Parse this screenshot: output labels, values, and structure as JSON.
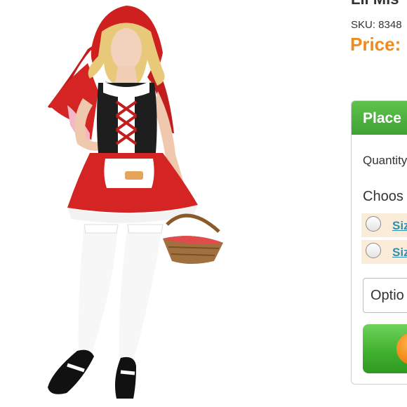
{
  "product": {
    "title": "Lil Mis",
    "sku": "SKU: 8348",
    "price_label": "Price:",
    "image_alt": "Red riding hood costume"
  },
  "order_box": {
    "header": "Place",
    "quantity_label": "Quantity",
    "choose_label": "Choos",
    "size_options": [
      "Siz",
      "Siz"
    ],
    "options_select": "Optio",
    "add_to_cart_icon": "cart-icon"
  },
  "colors": {
    "price": "#f08a1c",
    "header_green": "#4cb43a",
    "link_blue": "#2f8fb3",
    "option_row_bg": "#fbecd9",
    "cape_red": "#d42424"
  }
}
